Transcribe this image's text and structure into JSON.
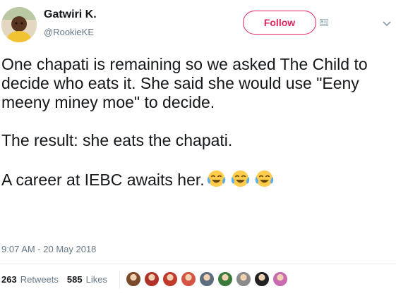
{
  "user": {
    "name": "Gatwiri K.",
    "handle": "@RookieKE",
    "avatar_icon": "user-avatar"
  },
  "follow": {
    "label": "Follow",
    "color": "#e0245e"
  },
  "tweet": {
    "lines": [
      "One chapati is remaining so we asked The Child to decide who eats it. She said she would use \"Eeny meeny miney moe\" to decide.",
      "The result: she eats the chapati.",
      "A career at IEBC awaits her."
    ],
    "emojis": [
      "face-with-tears-of-joy",
      "face-with-tears-of-joy",
      "face-with-tears-of-joy"
    ]
  },
  "timestamp": "9:07 AM - 20 May 2018",
  "stats": {
    "retweets_count": "263",
    "retweets_label": "Retweets",
    "likes_count": "585",
    "likes_label": "Likes"
  },
  "likers": [
    "#7a4a2a",
    "#b1322b",
    "#c0392b",
    "#d35445",
    "#5d6d7e",
    "#3b7a3b",
    "#8a8a8a",
    "#222222",
    "#c96bb0"
  ]
}
